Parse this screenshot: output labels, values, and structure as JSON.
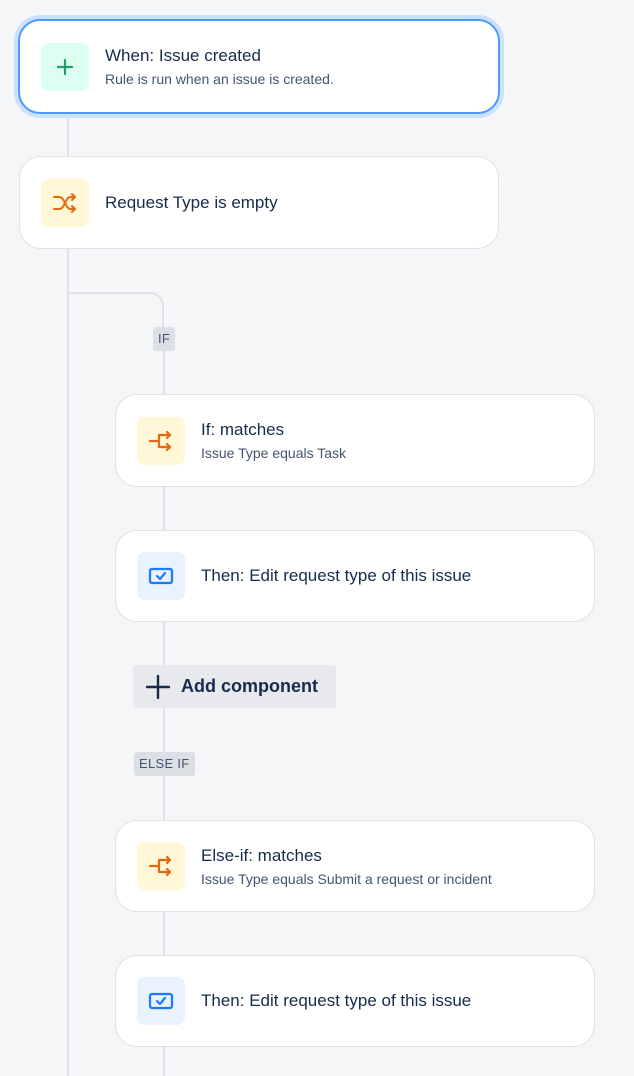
{
  "trigger": {
    "icon": "plus-icon",
    "title": "When: Issue created",
    "subtitle": "Rule is run when an issue is created."
  },
  "branch_rule": {
    "icon": "shuffle-icon",
    "title": "Request Type is empty"
  },
  "if_label": "IF",
  "if_condition": {
    "icon": "branch-arrow-icon",
    "title": "If: matches",
    "subtitle": "Issue Type equals Task"
  },
  "if_action": {
    "icon": "edit-request-icon",
    "title": "Then: Edit request type of this issue"
  },
  "add_component": {
    "icon": "plus-icon",
    "label": "Add component"
  },
  "else_if_label": "ELSE IF",
  "else_if_condition": {
    "icon": "branch-arrow-icon",
    "title": "Else-if: matches",
    "subtitle": "Issue Type equals Submit a request or incident"
  },
  "else_if_action": {
    "icon": "edit-request-icon",
    "title": "Then: Edit request type of this issue"
  },
  "colors": {
    "selected_border": "#4c9aff",
    "green_icon": "#22a06b",
    "orange_icon": "#e56910",
    "blue_icon": "#1d7afc"
  }
}
